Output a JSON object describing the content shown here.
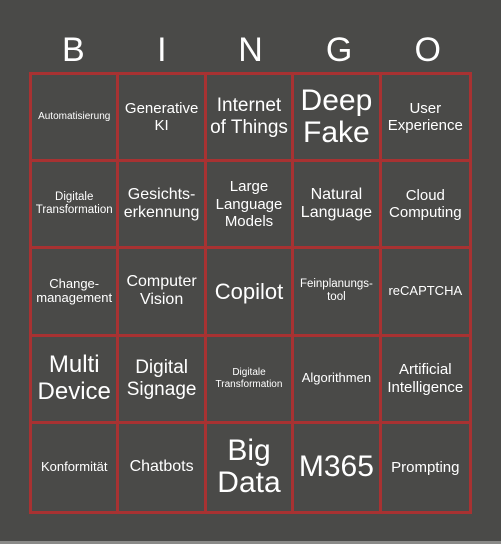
{
  "header": [
    "B",
    "I",
    "N",
    "G",
    "O"
  ],
  "colors": {
    "background": "#4a4a48",
    "grid_line": "#a83232",
    "text": "#ffffff"
  },
  "cells": [
    "Automatisierung",
    "Generative KI",
    "Internet of Things",
    "Deep Fake",
    "User Experience",
    "Digitale Transformation",
    "Gesichts-erkennung",
    "Large Language Models",
    "Natural Language",
    "Cloud Computing",
    "Change-management",
    "Computer Vision",
    "Copilot",
    "Feinplanungs-tool",
    "reCAPTCHA",
    "Multi Device",
    "Digital Signage",
    "Digitale Transformation",
    "Algorithmen",
    "Artificial Intelligence",
    "Konformität",
    "Chatbots",
    "Big Data",
    "M365",
    "Prompting"
  ]
}
